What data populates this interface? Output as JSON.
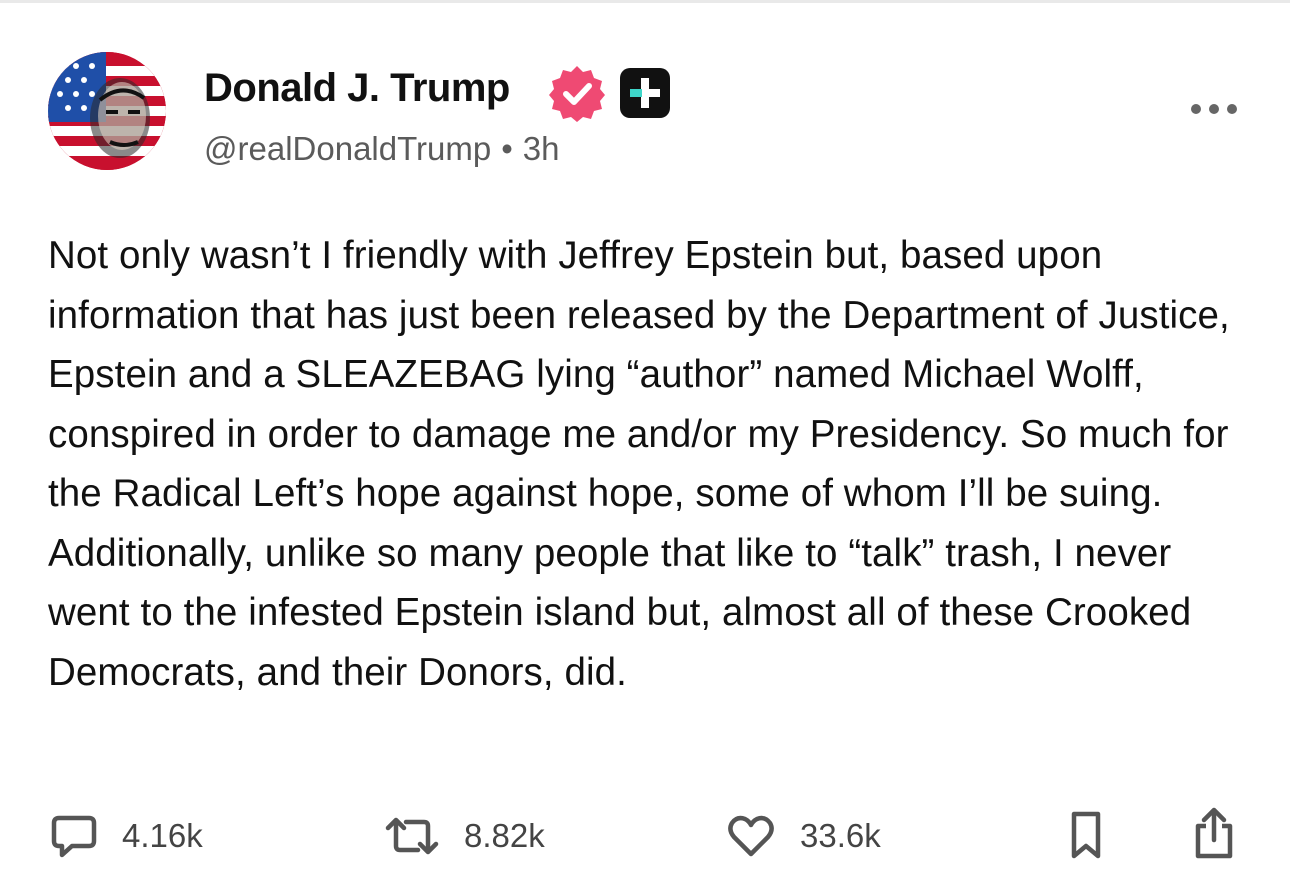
{
  "post": {
    "author_name": "Donald J. Trump",
    "handle": "@realDonaldTrump",
    "separator": "•",
    "time_ago": "3h",
    "body": "Not only wasn’t I friendly with Jeffrey Epstein but, based upon information that has just been released by the Department of Justice, Epstein and a SLEAZEBAG lying “author” named Michael Wolff, conspired in order to damage me and/or my Presidency. So much for the Radical Left’s hope against hope, some of whom I’ll be suing. Additionally, unlike so many people that like to “talk” trash, I never went to the infested Epstein island but, almost all of these Crooked Democrats, and their Donors, did."
  },
  "actions": {
    "replies": "4.16k",
    "retruths": "8.82k",
    "likes": "33.6k"
  },
  "icons": {
    "avatar": "profile-avatar",
    "verified": "verified-badge-icon",
    "plus": "plus-subscriber-icon",
    "more": "more-options-icon",
    "reply": "comment-icon",
    "retruth": "repost-icon",
    "like": "heart-icon",
    "bookmark": "bookmark-icon",
    "share": "share-icon"
  },
  "colors": {
    "verified_badge": "#ef4a73",
    "plus_badge_bg": "#111111",
    "plus_badge_accent": "#3ed6c9",
    "text_primary": "#111111",
    "text_secondary": "#5b5b5b"
  }
}
